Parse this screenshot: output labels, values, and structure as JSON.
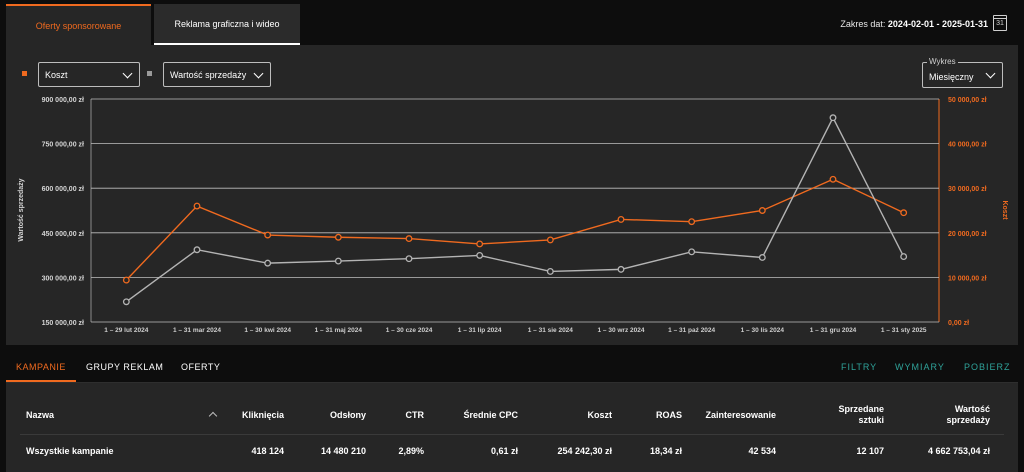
{
  "tabs": [
    {
      "label": "Oferty sponsorowane"
    },
    {
      "label": "Reklama graficzna i wideo"
    }
  ],
  "date_range": {
    "label": "Zakres dat:",
    "value": "2024-02-01 - 2025-01-31",
    "calendar_day": "31"
  },
  "controls": {
    "metric1": {
      "value": "Koszt",
      "color": "#f06a1f"
    },
    "metric2": {
      "value": "Wartość sprzedaży",
      "color": "#9a9a9a"
    },
    "chart_mode": {
      "legend": "Wykres",
      "value": "Miesięczny"
    }
  },
  "chart_data": {
    "type": "line",
    "categories": [
      "1 – 29 lut 2024",
      "1 – 31 mar 2024",
      "1 – 30 kwi 2024",
      "1 – 31 maj 2024",
      "1 – 30 cze 2024",
      "1 – 31 lip 2024",
      "1 – 31 sie 2024",
      "1 – 30 wrz 2024",
      "1 – 31 paź 2024",
      "1 – 30 lis 2024",
      "1 – 31 gru 2024",
      "1 – 31 sty 2025"
    ],
    "series": [
      {
        "name": "Koszt",
        "axis": "right",
        "color": "#f06a1f",
        "values": [
          9400,
          26000,
          19500,
          19000,
          18700,
          17500,
          18400,
          23000,
          22500,
          25000,
          32000,
          24500
        ]
      },
      {
        "name": "Wartość sprzedaży",
        "axis": "left",
        "color": "#b4b4b4",
        "values": [
          218000,
          393000,
          348000,
          355000,
          363000,
          374000,
          320000,
          327000,
          386000,
          367000,
          837000,
          370000
        ]
      }
    ],
    "ylabel_left": "Wartość sprzedaży",
    "ylabel_right": "Koszt",
    "left_ticks": [
      "900 000,00 zł",
      "750 000,00 zł",
      "600 000,00 zł",
      "450 000,00 zł",
      "300 000,00 zł",
      "150 000,00 zł"
    ],
    "right_ticks": [
      "50 000,00 zł",
      "40 000,00 zł",
      "30 000,00 zł",
      "20 000,00 zł",
      "10 000,00 zł",
      "0,00 zł"
    ],
    "ylim_left": [
      150000,
      900000
    ],
    "ylim_right": [
      0,
      50000
    ],
    "grid": true
  },
  "bottom_tabs": [
    {
      "label": "KAMPANIE"
    },
    {
      "label": "GRUPY REKLAM"
    },
    {
      "label": "OFERTY"
    }
  ],
  "actions": [
    {
      "label": "FILTRY"
    },
    {
      "label": "WYMIARY"
    },
    {
      "label": "POBIERZ"
    }
  ],
  "table": {
    "headers": {
      "nazwa": "Nazwa",
      "klikniecia": "Kliknięcia",
      "odslony": "Odsłony",
      "ctr": "CTR",
      "cpc": "Średnie CPC",
      "koszt": "Koszt",
      "roas": "ROAS",
      "zainteresowanie": "Zainteresowanie",
      "sztuki_1": "Sprzedane",
      "sztuki_2": "sztuki",
      "wartosc_1": "Wartość",
      "wartosc_2": "sprzedaży"
    },
    "rows": [
      {
        "nazwa": "Wszystkie kampanie",
        "klikniecia": "418 124",
        "odslony": "14 480 210",
        "ctr": "2,89%",
        "cpc": "0,61 zł",
        "koszt": "254 242,30 zł",
        "roas": "18,34 zł",
        "zainteresowanie": "42 534",
        "sztuki": "12 107",
        "wartosc": "4 662 753,04 zł"
      }
    ]
  }
}
